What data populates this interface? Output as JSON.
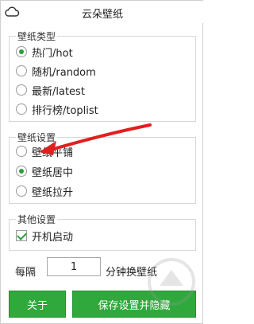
{
  "window": {
    "title": "云朵壁纸"
  },
  "groups": {
    "type": {
      "title": "壁纸类型",
      "options": [
        {
          "label": "热门/hot",
          "checked": true
        },
        {
          "label": "随机/random",
          "checked": false
        },
        {
          "label": "最新/latest",
          "checked": false
        },
        {
          "label": "排行榜/toplist",
          "checked": false
        }
      ]
    },
    "display": {
      "title": "壁纸设置",
      "options": [
        {
          "label": "壁纸平铺",
          "checked": false
        },
        {
          "label": "壁纸居中",
          "checked": true
        },
        {
          "label": "壁纸拉升",
          "checked": false
        }
      ]
    },
    "other": {
      "title": "其他设置",
      "autostart_label": "开机启动",
      "autostart_checked": true
    }
  },
  "interval": {
    "prefix": "每隔",
    "value": "1",
    "suffix": "分钟换壁纸"
  },
  "buttons": {
    "about": "关于",
    "save": "保存设置并隐藏"
  },
  "colors": {
    "accent": "#2fa93c",
    "annotation_arrow": "#e02020"
  }
}
